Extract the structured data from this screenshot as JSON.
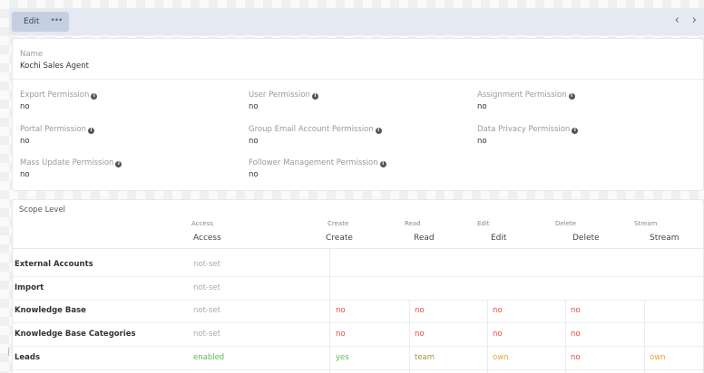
{
  "toolbar": {
    "edit_label": "Edit",
    "more_label": "•••",
    "prev_label": "‹",
    "next_label": "›"
  },
  "record": {
    "name_label": "Name",
    "name_value": "Kochi Sales Agent"
  },
  "permissions": [
    {
      "label": "Export Permission",
      "value": "no"
    },
    {
      "label": "User Permission",
      "value": "no"
    },
    {
      "label": "Assignment Permission",
      "value": "no"
    },
    {
      "label": "Portal Permission",
      "value": "no"
    },
    {
      "label": "Group Email Account Permission",
      "value": "no"
    },
    {
      "label": "Data Privacy Permission",
      "value": "no"
    },
    {
      "label": "Mass Update Permission",
      "value": "no"
    },
    {
      "label": "Follower Management Permission",
      "value": "no"
    }
  ],
  "scope": {
    "title": "Scope Level",
    "columns": [
      "Access",
      "Create",
      "Read",
      "Edit",
      "Delete",
      "Stream"
    ],
    "rows": [
      {
        "label": "External Accounts",
        "access": "not-set",
        "cells": []
      },
      {
        "label": "Import",
        "access": "not-set",
        "cells": []
      },
      {
        "label": "Knowledge Base",
        "access": "not-set",
        "cells": [
          "no",
          "no",
          "no",
          "no"
        ]
      },
      {
        "label": "Knowledge Base Categories",
        "access": "not-set",
        "cells": [
          "no",
          "no",
          "no",
          "no"
        ]
      },
      {
        "label": "Leads",
        "access": "enabled",
        "cells": [
          "yes",
          "team",
          "own",
          "no",
          "own"
        ]
      }
    ]
  },
  "colors": {
    "no": "#e74c3c",
    "yes": "#5cb85c",
    "team": "#999933",
    "own": "#e6a23c",
    "not_set": "#aaaaaa",
    "enabled": "#5cb85c"
  }
}
